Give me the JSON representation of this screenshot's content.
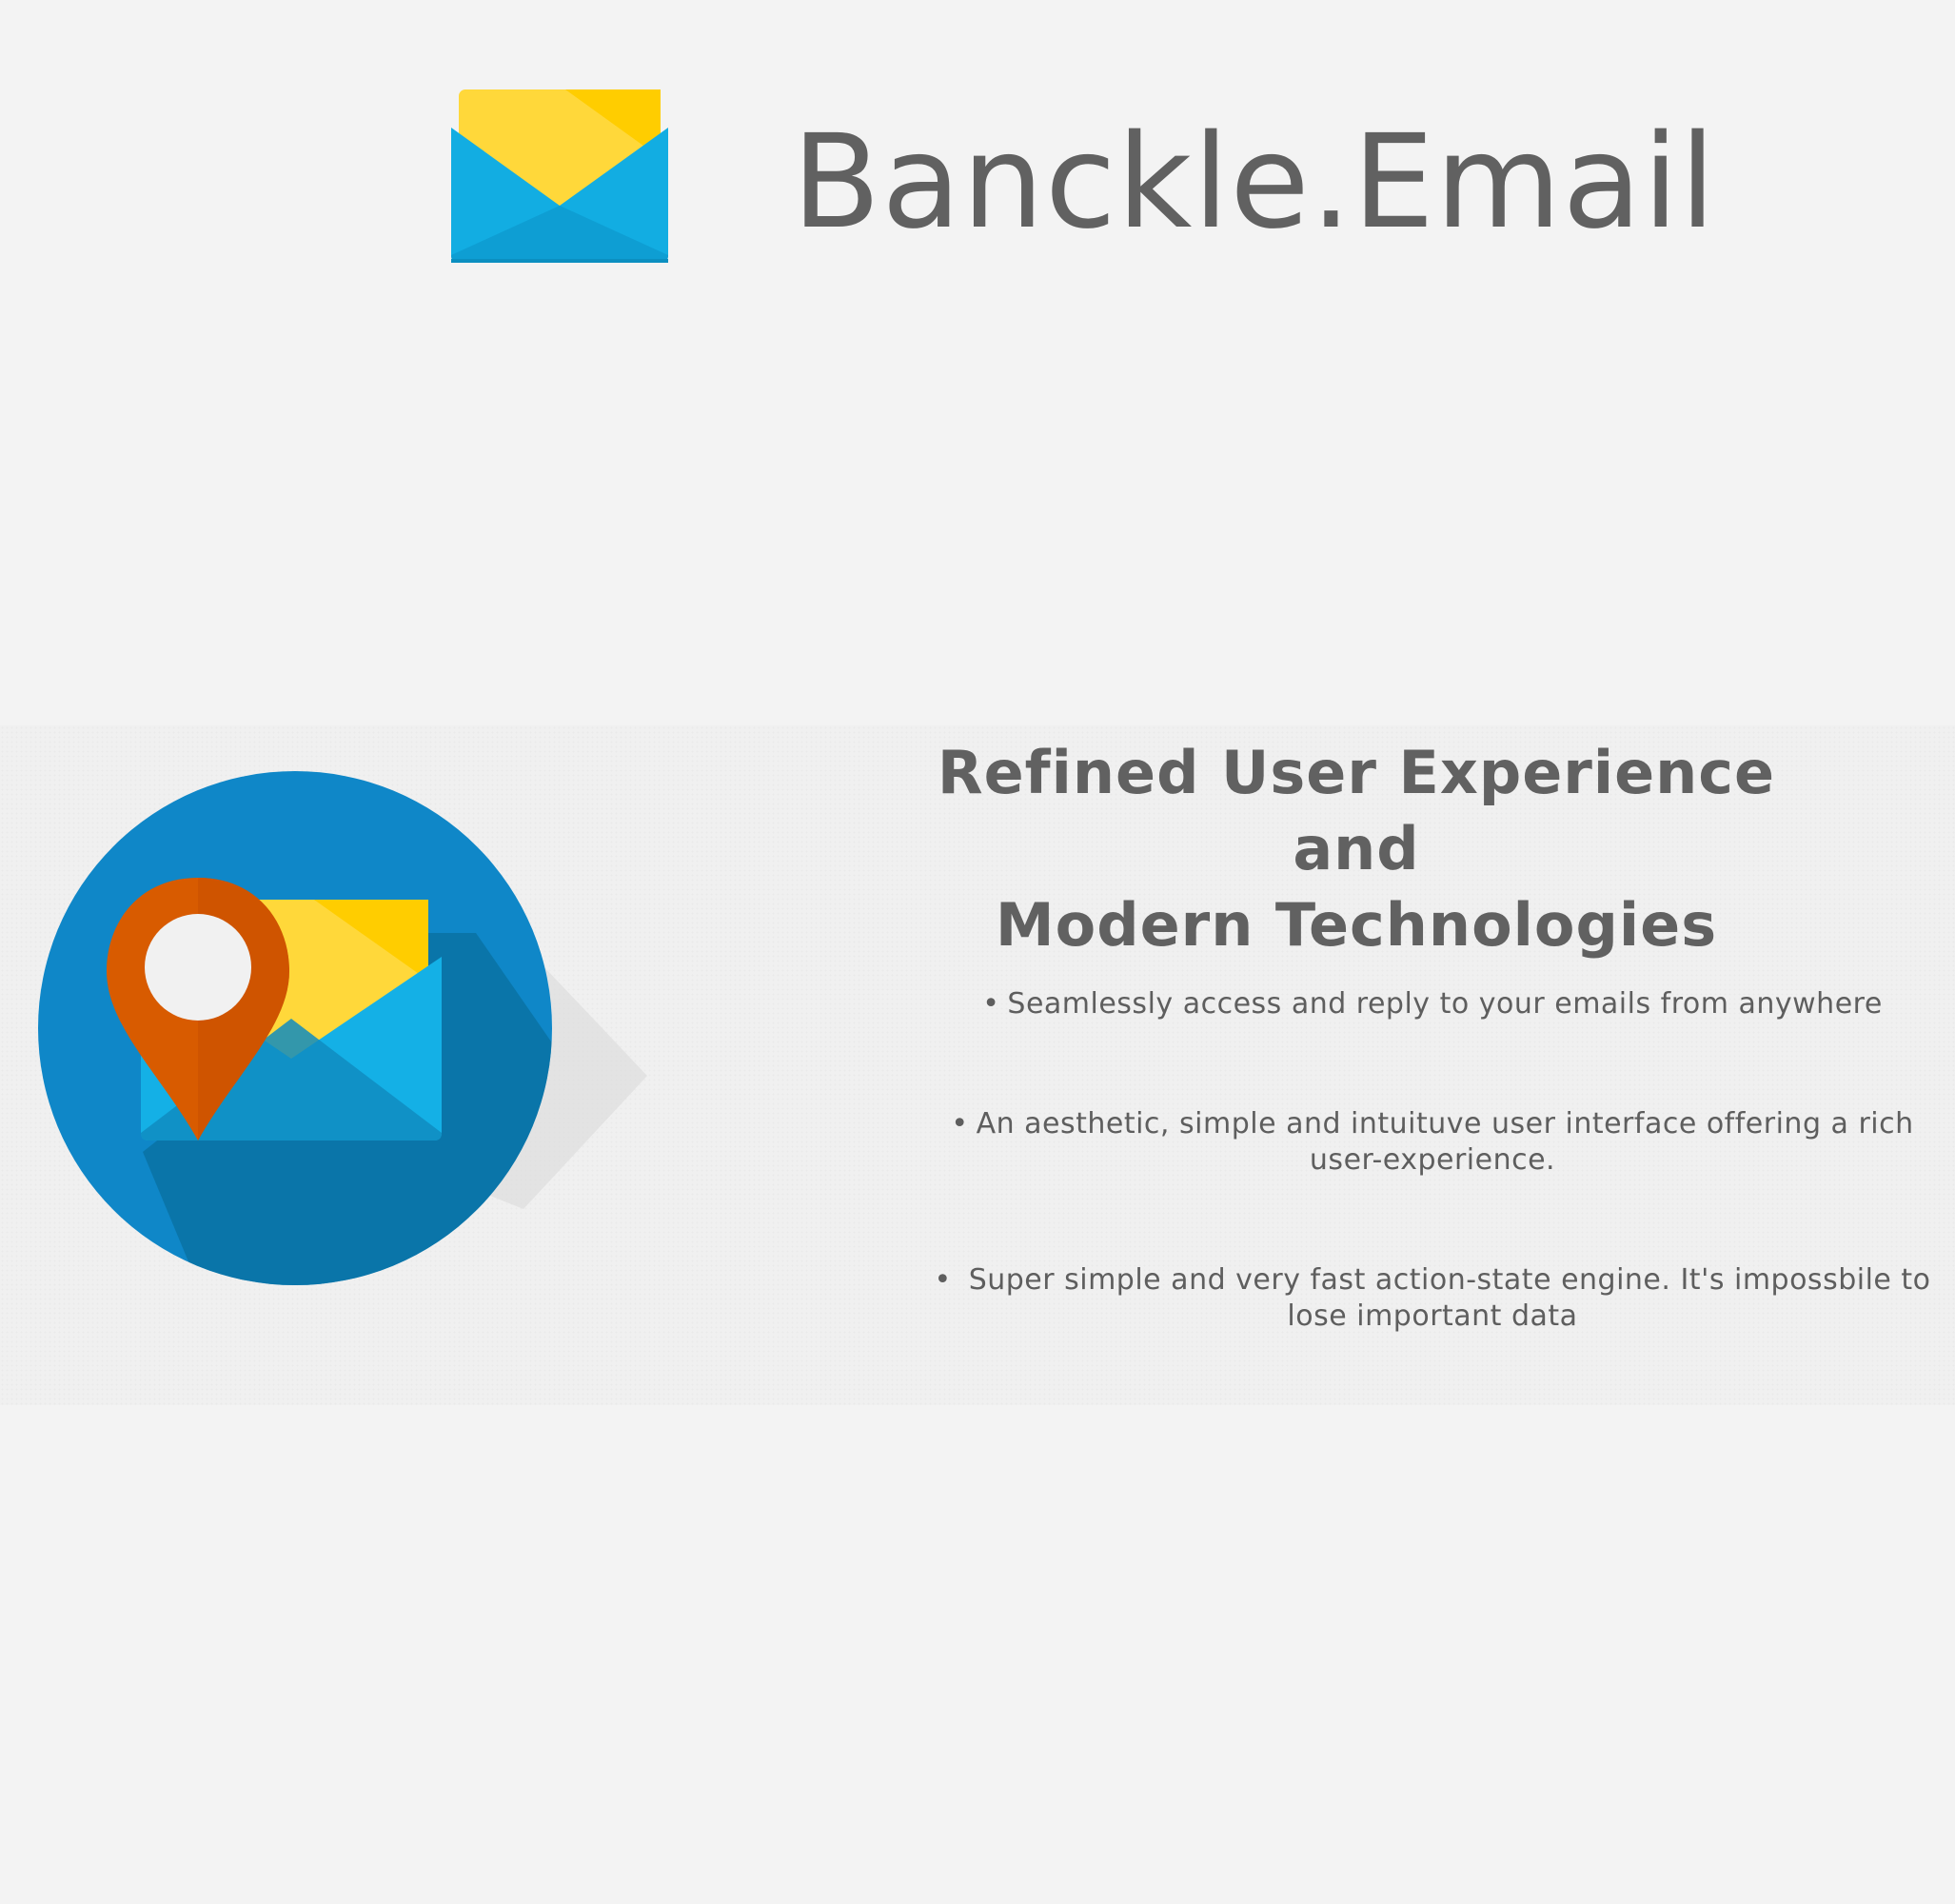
{
  "header": {
    "title": "Banckle.Email",
    "logo_icon": "envelope-icon"
  },
  "feature_section": {
    "heading_line_1": "Refined User Experience and",
    "heading_line_2": "Modern Technologies",
    "illustration_icon": "location-mail-icon",
    "bullet": "•",
    "items": [
      {
        "text": "Seamlessly access and reply to your emails from anywhere"
      },
      {
        "text": "An aesthetic, simple and intuituve user interface offering a rich user-experience."
      },
      {
        "text": " Super simple and very fast action-state engine. It's impossbile to lose important data"
      }
    ]
  },
  "colors": {
    "background": "#f3f3f3",
    "text": "#616161",
    "envelope_blue": "#12ade2",
    "envelope_yellow": "#ffcd00",
    "circle_blue": "#0f87c8",
    "pin_orange": "#d85b00"
  }
}
